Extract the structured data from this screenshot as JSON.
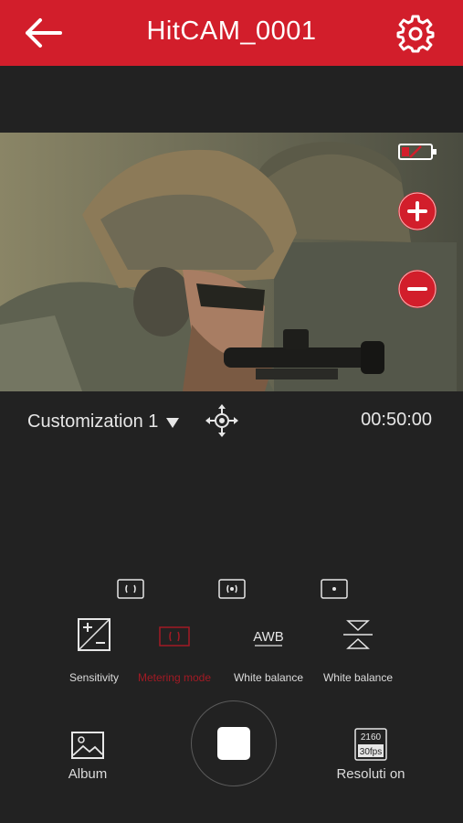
{
  "header": {
    "title": "HitCAM_0001",
    "back_icon": "arrow-left-icon",
    "settings_icon": "gear-icon",
    "color": "#d21e2b"
  },
  "viewer": {
    "battery_icon": "battery-low-icon",
    "zoom_in_icon": "plus-icon",
    "zoom_out_icon": "minus-icon"
  },
  "info": {
    "mode_label": "Customization 1",
    "mode_icon": "caret-down-icon",
    "move_icon": "move-arrows-icon",
    "timer": "00:50:00"
  },
  "metering_options": [
    {
      "icon": "metering-average-icon"
    },
    {
      "icon": "metering-center-icon"
    },
    {
      "icon": "metering-spot-icon"
    }
  ],
  "settings": [
    {
      "label": "Sensitivity",
      "icon": "exposure-icon",
      "active": false
    },
    {
      "label": "Metering mode",
      "icon": "metering-icon",
      "active": true
    },
    {
      "label": "White balance",
      "icon": "awb-icon",
      "icon_text": "AWB",
      "active": false
    },
    {
      "label": "White balance",
      "icon": "flip-icon",
      "active": false
    }
  ],
  "bottom": {
    "album_label": "Album",
    "album_icon": "image-icon",
    "shutter_icon": "record-stop-icon",
    "resolution_label": "Resoluti on",
    "resolution_icon": "resolution-badge-icon",
    "resolution_top": "2160",
    "resolution_bottom": "30fps"
  },
  "accent_color": "#d21e2b"
}
